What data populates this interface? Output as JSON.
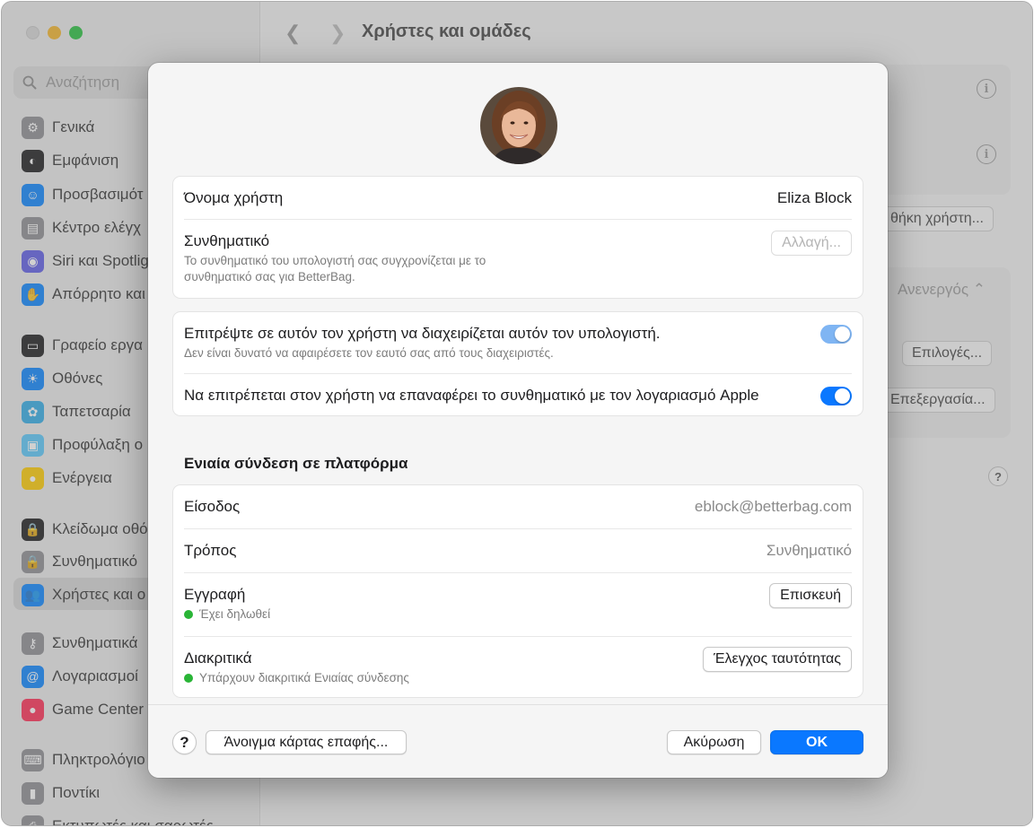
{
  "window": {
    "title": "Χρήστες και ομάδες"
  },
  "sidebar": {
    "search_placeholder": "Αναζήτηση",
    "items": [
      {
        "label": "Γενικά",
        "icon": "gear-icon",
        "color": "#8e8e93"
      },
      {
        "label": "Εμφάνιση",
        "icon": "appearance-icon",
        "color": "#1c1c1e"
      },
      {
        "label": "Προσβασιμότ",
        "icon": "accessibility-icon",
        "color": "#0a84ff"
      },
      {
        "label": "Κέντρο ελέγχ",
        "icon": "control-center-icon",
        "color": "#8e8e93"
      },
      {
        "label": "Siri και Spotlig",
        "icon": "siri-icon",
        "color": "#5e5ce6"
      },
      {
        "label": "Απόρρητο και",
        "icon": "hand-icon",
        "color": "#0a84ff"
      },
      {
        "label": "Γραφείο εργα",
        "icon": "desktop-icon",
        "color": "#1c1c1e"
      },
      {
        "label": "Οθόνες",
        "icon": "sun-icon",
        "color": "#0a84ff"
      },
      {
        "label": "Ταπετσαρία",
        "icon": "flower-icon",
        "color": "#32ade6"
      },
      {
        "label": "Προφύλαξη ο",
        "icon": "screensaver-icon",
        "color": "#5ac8fa"
      },
      {
        "label": "Ενέργεια",
        "icon": "bulb-icon",
        "color": "#ffcc00"
      },
      {
        "label": "Κλείδωμα οθό",
        "icon": "lock-icon",
        "color": "#1c1c1e"
      },
      {
        "label": "Συνθηματικό",
        "icon": "lock-icon",
        "color": "#8e8e93"
      },
      {
        "label": "Χρήστες και ο",
        "icon": "users-icon",
        "color": "#0a84ff"
      },
      {
        "label": "Συνθηματικά",
        "icon": "key-icon",
        "color": "#8e8e93"
      },
      {
        "label": "Λογαριασμοί",
        "icon": "at-icon",
        "color": "#0a84ff"
      },
      {
        "label": "Game Center",
        "icon": "game-center-icon",
        "color": "#ff2d55"
      },
      {
        "label": "Πληκτρολόγιο",
        "icon": "keyboard-icon",
        "color": "#8e8e93"
      },
      {
        "label": "Ποντίκι",
        "icon": "mouse-icon",
        "color": "#8e8e93"
      },
      {
        "label": "Εκτυπωτές και σαρωτές",
        "icon": "printer-icon",
        "color": "#8e8e93"
      }
    ]
  },
  "background": {
    "add_user_button": "θήκη χρήστη...",
    "auto_login_value": "Ανενεργός",
    "options_button": "Επιλογές...",
    "edit_button": "Επεξεργασία...",
    "help": "?"
  },
  "sheet": {
    "username_label": "Όνομα χρήστη",
    "username_value": "Eliza Block",
    "password_label": "Συνθηματικό",
    "password_sub_line1": "Το συνθηματικό του υπολογιστή σας συγχρονίζεται με το",
    "password_sub_line2": "συνθηματικό σας για BetterBag.",
    "change_button": "Αλλαγή...",
    "admin_label": "Επιτρέψτε σε αυτόν τον χρήστη να διαχειρίζεται αυτόν τον υπολογιστή.",
    "admin_sub": "Δεν είναι δυνατό να αφαιρέσετε τον εαυτό σας από τους διαχειριστές.",
    "admin_toggle_on": true,
    "reset_label": "Να επιτρέπεται στον χρήστη να επαναφέρει το συνθηματικό με τον λογαριασμό Apple",
    "reset_toggle_on": true,
    "sso_title": "Ενιαία σύνδεση σε πλατφόρμα",
    "login_label": "Είσοδος",
    "login_value": "eblock@betterbag.com",
    "method_label": "Τρόπος",
    "method_value": "Συνθηματικό",
    "registration_label": "Εγγραφή",
    "registration_status": "Έχει δηλωθεί",
    "repair_button": "Επισκευή",
    "tokens_label": "Διακριτικά",
    "tokens_status": "Υπάρχουν διακριτικά Ενιαίας σύνδεσης",
    "authenticate_button": "Έλεγχος ταυτότητας",
    "status_color": "#2ab537",
    "accent_color": "#0a78ff"
  },
  "footer": {
    "help": "?",
    "open_contact_button": "Άνοιγμα κάρτας επαφής...",
    "cancel_button": "Ακύρωση",
    "ok_button": "OK"
  }
}
